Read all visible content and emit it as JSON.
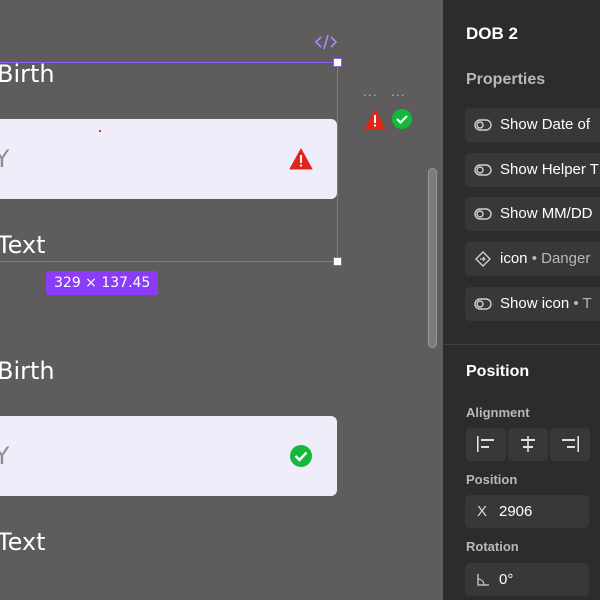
{
  "canvas": {
    "component_a": {
      "label": "Birth",
      "value": "YY",
      "helper": "Text",
      "status_icon": "warning-triangle-icon"
    },
    "component_b": {
      "label": "Birth",
      "value": "YY",
      "helper": "Text",
      "status_icon": "check-circle-icon"
    },
    "selection_size": "329 × 137.45",
    "variant_dots": [
      "...",
      "..."
    ]
  },
  "panel": {
    "title": "DOB 2",
    "properties_heading": "Properties",
    "properties": [
      {
        "icon": "toggle-icon",
        "text": "Show Date of",
        "suffix": ""
      },
      {
        "icon": "toggle-icon",
        "text": "Show Helper T",
        "suffix": ""
      },
      {
        "icon": "toggle-icon",
        "text": "Show MM/DD",
        "suffix": ""
      },
      {
        "icon": "instance-swap-icon",
        "text": "icon",
        "suffix": "• Danger"
      },
      {
        "icon": "toggle-icon",
        "text": "Show icon",
        "suffix": "• T"
      }
    ],
    "position_heading": "Position",
    "alignment_label": "Alignment",
    "position_label": "Position",
    "x_prefix": "X",
    "x_value": "2906",
    "rotation_label": "Rotation",
    "rotation_value": "0°"
  },
  "colors": {
    "canvas_bg": "#5e5c5d",
    "panel_bg": "#2c2c2c",
    "selection": "#8b5cf6",
    "danger": "#e0251b",
    "success": "#14b83a",
    "field_bg": "#efedf9"
  }
}
